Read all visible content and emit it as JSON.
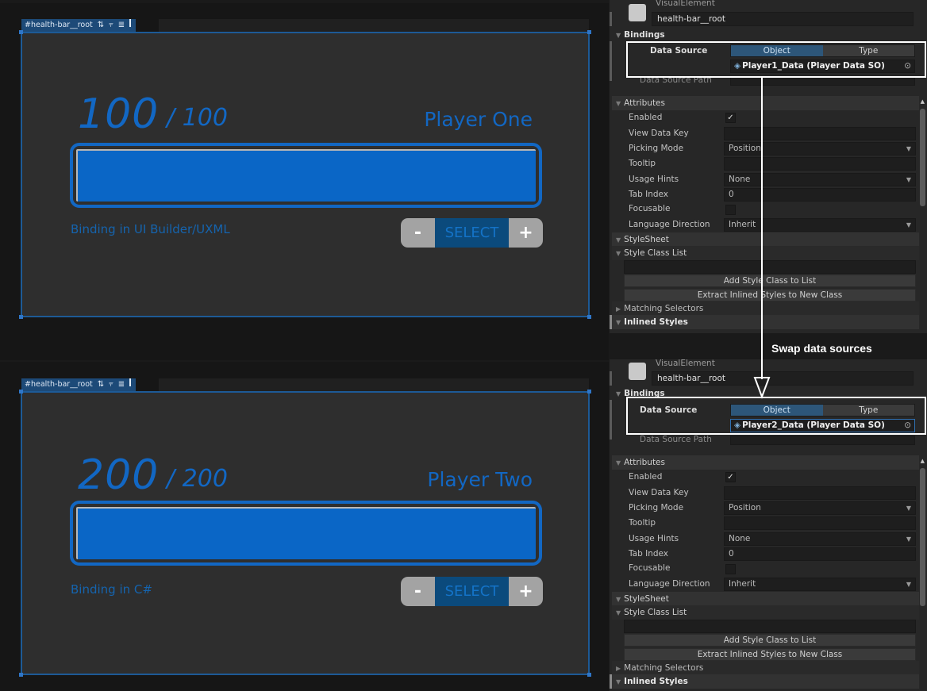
{
  "panels": [
    {
      "tag": "#health-bar__root",
      "hp_current": "100",
      "hp_max": "/ 100",
      "player_name": "Player One",
      "health_fraction": 1.0,
      "caption": "Binding in UI Builder/UXML",
      "selector": {
        "minus": "-",
        "label": "SELECT",
        "plus": "+"
      }
    },
    {
      "tag": "#health-bar__root",
      "hp_current": "200",
      "hp_max": "/ 200",
      "player_name": "Player Two",
      "health_fraction": 1.0,
      "caption": "Binding in C#",
      "selector": {
        "minus": "-",
        "label": "SELECT",
        "plus": "+"
      }
    }
  ],
  "inspectors": [
    {
      "element_type": "VisualElement",
      "element_name": "health-bar__root",
      "bindings_header": "Bindings",
      "data_source_label": "Data Source",
      "toggle": [
        "Object",
        "Type"
      ],
      "data_source_value": "Player1_Data (Player Data SO)",
      "data_source_path_label": "Data Source Path",
      "attributes_header": "Attributes",
      "attributes": {
        "enabled_label": "Enabled",
        "enabled": true,
        "view_data_key_label": "View Data Key",
        "picking_mode_label": "Picking Mode",
        "picking_mode": "Position",
        "tooltip_label": "Tooltip",
        "usage_hints_label": "Usage Hints",
        "usage_hints": "None",
        "tab_index_label": "Tab Index",
        "tab_index": "0",
        "focusable_label": "Focusable",
        "language_direction_label": "Language Direction",
        "language_direction": "Inherit"
      },
      "stylesheet_header": "StyleSheet",
      "style_class_list_header": "Style Class List",
      "add_style_class": "Add Style Class to List",
      "extract_styles": "Extract Inlined Styles to New Class",
      "matching_selectors": "Matching Selectors",
      "inlined_styles": "Inlined Styles"
    },
    {
      "element_type": "VisualElement",
      "element_name": "health-bar__root",
      "bindings_header": "Bindings",
      "data_source_label": "Data Source",
      "toggle": [
        "Object",
        "Type"
      ],
      "data_source_value": "Player2_Data (Player Data SO)",
      "data_source_path_label": "Data Source Path",
      "attributes_header": "Attributes",
      "attributes": {
        "enabled_label": "Enabled",
        "enabled": true,
        "view_data_key_label": "View Data Key",
        "picking_mode_label": "Picking Mode",
        "picking_mode": "Position",
        "tooltip_label": "Tooltip",
        "usage_hints_label": "Usage Hints",
        "usage_hints": "None",
        "tab_index_label": "Tab Index",
        "tab_index": "0",
        "focusable_label": "Focusable",
        "language_direction_label": "Language Direction",
        "language_direction": "Inherit"
      },
      "stylesheet_header": "StyleSheet",
      "style_class_list_header": "Style Class List",
      "add_style_class": "Add Style Class to List",
      "extract_styles": "Extract Inlined Styles to New Class",
      "matching_selectors": "Matching Selectors",
      "inlined_styles": "Inlined Styles"
    }
  ],
  "annotation": {
    "label": "Swap data sources"
  },
  "icons": {
    "tag_icons": [
      "sort-icon",
      "align-top-icon",
      "align-middle-icon",
      "pin-right-icon"
    ],
    "asset_icon": "scriptable-object-icon",
    "target_icon": "object-picker-icon",
    "foldout_icon": "triangle-icon",
    "dropdown_icon": "chevron-down-icon",
    "checkmark_icon": "checkmark-icon"
  },
  "colors": {
    "accent_blue": "#1267c3",
    "bar_fill": "#0a66c6",
    "panel_bg": "#2e2e2e",
    "inspector_bg": "#272727",
    "highlight": "#ffffff"
  }
}
